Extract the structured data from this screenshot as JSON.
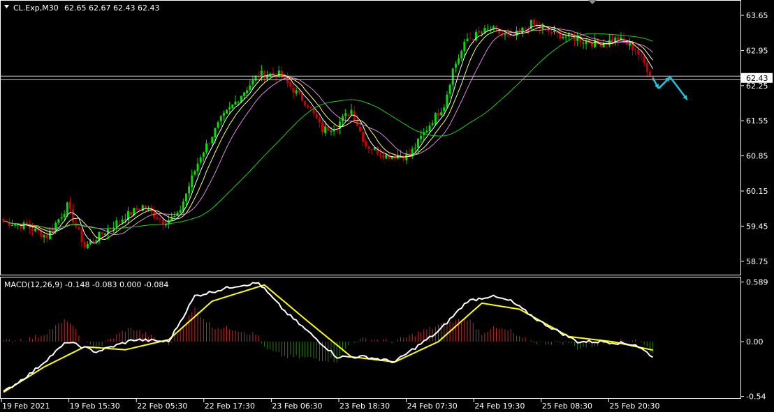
{
  "header": {
    "symbol": "CL.Exp,M30",
    "ohlc": "62.65 62.67 62.43 62.43",
    "macd": "MACD(12,26,9) -0.148 -0.083 0.000 -0.084"
  },
  "price_axis": {
    "ticks": [
      "63.65",
      "62.95",
      "62.25",
      "61.55",
      "60.85",
      "60.15",
      "59.45",
      "58.75"
    ],
    "current_label": "62.43"
  },
  "macd_axis": {
    "ticks": [
      "0.589",
      "0.00",
      "-0.54"
    ]
  },
  "time_axis": {
    "ticks": [
      "19 Feb 2021",
      "19 Feb 15:30",
      "22 Feb 05:30",
      "22 Feb 17:30",
      "23 Feb 06:30",
      "23 Feb 18:30",
      "24 Feb 07:30",
      "24 Feb 19:30",
      "25 Feb 08:30",
      "25 Feb 20:30"
    ]
  },
  "colors": {
    "bull": "#00e000",
    "bear": "#cc0000",
    "ma_fast": "#ffffff",
    "ma_mid": "#ffff66",
    "ma_slow": "#dd88dd",
    "ma_long": "#22cc22",
    "macd_line": "#ffffff",
    "signal_line": "#ffff00",
    "hist_pos": "#b83030",
    "hist_neg": "#2f7a1e",
    "arrow": "#22c4dd",
    "grid_frame": "#ffffff"
  },
  "chart_data": {
    "type": "candlestick",
    "price_range": [
      58.6,
      63.9
    ],
    "macd_range": [
      -0.55,
      0.62
    ],
    "price_anchors": [
      [
        0,
        59.6
      ],
      [
        8,
        59.5
      ],
      [
        15,
        59.3
      ],
      [
        22,
        59.9
      ],
      [
        28,
        59.1
      ],
      [
        35,
        59.4
      ],
      [
        42,
        59.7
      ],
      [
        48,
        59.9
      ],
      [
        55,
        59.6
      ],
      [
        60,
        59.7
      ],
      [
        68,
        60.9
      ],
      [
        75,
        61.6
      ],
      [
        82,
        62.1
      ],
      [
        88,
        62.5
      ],
      [
        95,
        62.5
      ],
      [
        100,
        62.2
      ],
      [
        105,
        61.9
      ],
      [
        110,
        61.4
      ],
      [
        115,
        61.5
      ],
      [
        120,
        61.8
      ],
      [
        125,
        61.1
      ],
      [
        132,
        60.9
      ],
      [
        140,
        60.9
      ],
      [
        148,
        61.6
      ],
      [
        152,
        61.9
      ],
      [
        155,
        62.6
      ],
      [
        160,
        63.2
      ],
      [
        168,
        63.4
      ],
      [
        175,
        63.2
      ],
      [
        182,
        63.5
      ],
      [
        190,
        63.3
      ],
      [
        198,
        63.2
      ],
      [
        205,
        63.1
      ],
      [
        212,
        63.2
      ],
      [
        218,
        63.0
      ],
      [
        224,
        62.43
      ]
    ],
    "last_close": 62.43,
    "macd_anchors": [
      [
        0,
        -0.5
      ],
      [
        10,
        -0.3
      ],
      [
        22,
        0.0
      ],
      [
        32,
        -0.1
      ],
      [
        45,
        0.02
      ],
      [
        57,
        0.0
      ],
      [
        66,
        0.45
      ],
      [
        80,
        0.55
      ],
      [
        88,
        0.58
      ],
      [
        97,
        0.3
      ],
      [
        115,
        -0.15
      ],
      [
        125,
        -0.15
      ],
      [
        135,
        -0.2
      ],
      [
        150,
        0.1
      ],
      [
        160,
        0.4
      ],
      [
        168,
        0.45
      ],
      [
        175,
        0.4
      ],
      [
        185,
        0.2
      ],
      [
        198,
        0.0
      ],
      [
        208,
        0.0
      ],
      [
        218,
        -0.03
      ],
      [
        224,
        -0.148
      ]
    ],
    "signal_anchors": [
      [
        0,
        -0.5
      ],
      [
        14,
        -0.25
      ],
      [
        28,
        -0.05
      ],
      [
        42,
        -0.08
      ],
      [
        57,
        0.02
      ],
      [
        72,
        0.4
      ],
      [
        90,
        0.56
      ],
      [
        105,
        0.2
      ],
      [
        120,
        -0.15
      ],
      [
        135,
        -0.2
      ],
      [
        150,
        0.0
      ],
      [
        165,
        0.38
      ],
      [
        178,
        0.32
      ],
      [
        195,
        0.05
      ],
      [
        210,
        0.0
      ],
      [
        224,
        -0.083
      ]
    ],
    "forecast_arrow_points": [
      [
        62.43,
        0
      ],
      [
        62.22,
        2
      ],
      [
        62.45,
        6
      ],
      [
        62.0,
        12
      ]
    ]
  }
}
